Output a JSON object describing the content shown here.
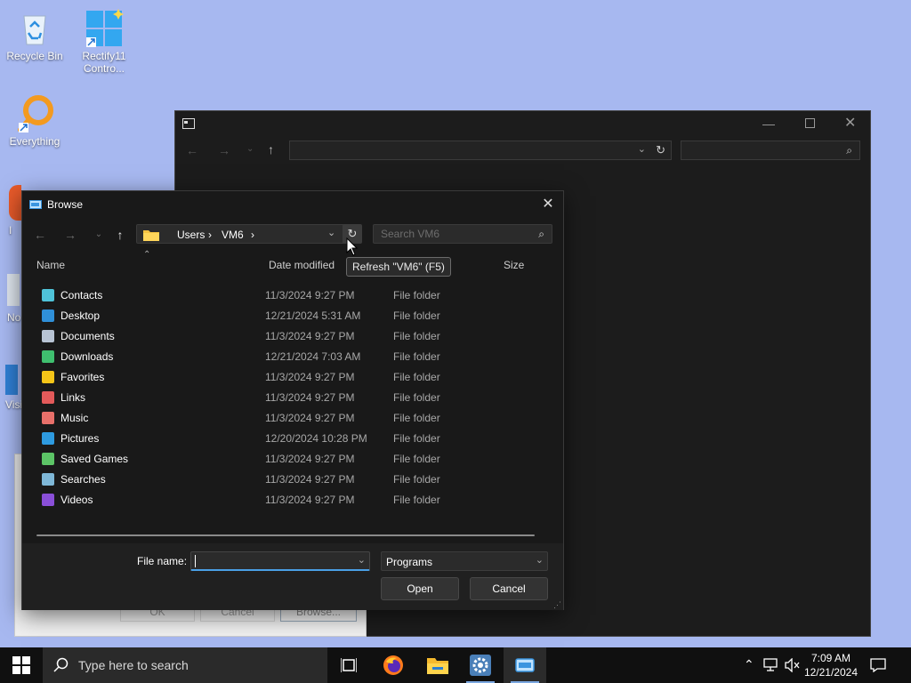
{
  "desktop": {
    "icons": [
      {
        "label": "Recycle Bin"
      },
      {
        "label": "Rectify11 Contro..."
      },
      {
        "label": "Everything"
      }
    ],
    "partial_labels": [
      "I",
      "No",
      "Visi",
      "V"
    ]
  },
  "old_dialog": {
    "ok_label": "OK",
    "cancel_label": "Cancel",
    "browse_label": "Browse..."
  },
  "browse_dialog": {
    "title": "Browse",
    "address": {
      "crumbs": [
        "Users",
        "VM6"
      ]
    },
    "search_placeholder": "Search VM6",
    "tooltip": "Refresh \"VM6\" (F5)",
    "columns": {
      "name": "Name",
      "date": "Date modified",
      "size": "Size"
    },
    "items": [
      {
        "name": "Contacts",
        "date": "11/3/2024 9:27 PM",
        "type": "File folder",
        "icon": "contacts-icon",
        "color": "#4fc3d9"
      },
      {
        "name": "Desktop",
        "date": "12/21/2024 5:31 AM",
        "type": "File folder",
        "icon": "desktop-icon",
        "color": "#2f8fd8"
      },
      {
        "name": "Documents",
        "date": "11/3/2024 9:27 PM",
        "type": "File folder",
        "icon": "documents-icon",
        "color": "#b8c4d4"
      },
      {
        "name": "Downloads",
        "date": "12/21/2024 7:03 AM",
        "type": "File folder",
        "icon": "downloads-icon",
        "color": "#3fbf6f"
      },
      {
        "name": "Favorites",
        "date": "11/3/2024 9:27 PM",
        "type": "File folder",
        "icon": "favorites-icon",
        "color": "#f5c518"
      },
      {
        "name": "Links",
        "date": "11/3/2024 9:27 PM",
        "type": "File folder",
        "icon": "links-icon",
        "color": "#e35a5a"
      },
      {
        "name": "Music",
        "date": "11/3/2024 9:27 PM",
        "type": "File folder",
        "icon": "music-icon",
        "color": "#e8706a"
      },
      {
        "name": "Pictures",
        "date": "12/20/2024 10:28 PM",
        "type": "File folder",
        "icon": "pictures-icon",
        "color": "#2e9be0"
      },
      {
        "name": "Saved Games",
        "date": "11/3/2024 9:27 PM",
        "type": "File folder",
        "icon": "saved-games-icon",
        "color": "#5cc466"
      },
      {
        "name": "Searches",
        "date": "11/3/2024 9:27 PM",
        "type": "File folder",
        "icon": "searches-icon",
        "color": "#7fb8d8"
      },
      {
        "name": "Videos",
        "date": "11/3/2024 9:27 PM",
        "type": "File folder",
        "icon": "videos-icon",
        "color": "#8a4fd8"
      }
    ],
    "file_name_label": "File name:",
    "file_name_value": "",
    "filter_value": "Programs",
    "open_label": "Open",
    "cancel_label": "Cancel"
  },
  "taskbar": {
    "search_placeholder": "Type here to search",
    "time": "7:09 AM",
    "date": "12/21/2024"
  },
  "colors": {
    "desktop_bg": "#a7b8f0",
    "dialog_bg": "#191919",
    "accent": "#4aa0e6"
  }
}
